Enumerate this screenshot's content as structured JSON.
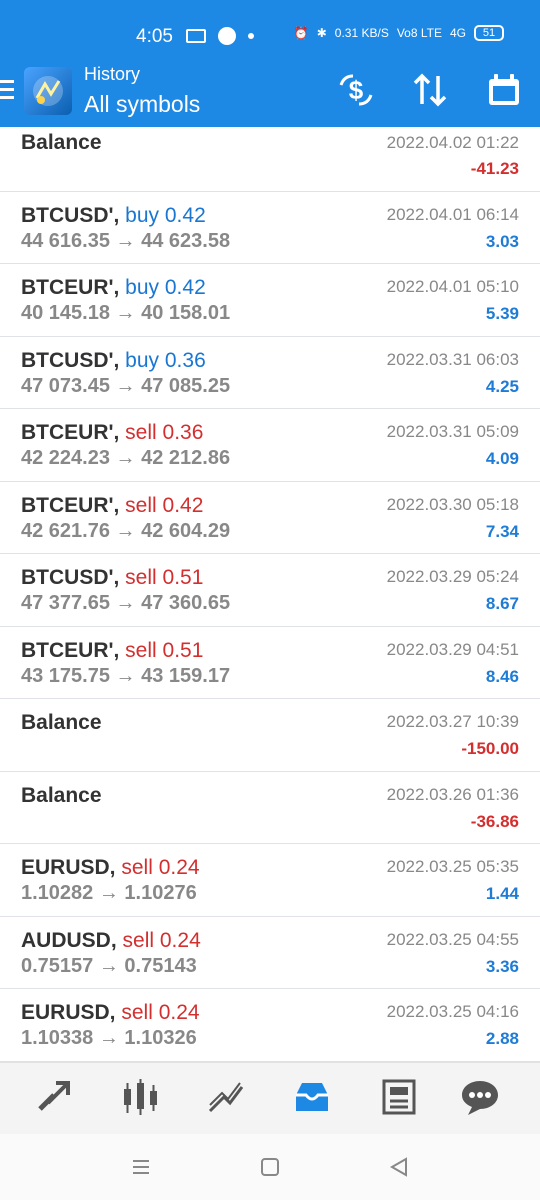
{
  "status_bar": {
    "time": "4:05",
    "net_speed": "0.31 KB/S",
    "volte": "Vo8 LTE",
    "signal": "4G",
    "battery": "51"
  },
  "header": {
    "title": "History",
    "subtitle": "All symbols"
  },
  "toolbar_icons": [
    "currency-exchange-icon",
    "sort-icon",
    "calendar-icon"
  ],
  "rows": [
    {
      "symbol": "Balance",
      "action": "",
      "volume": "",
      "prices": "",
      "date": "2022.04.02 01:22",
      "profit": "-41.23",
      "profit_sign": "neg"
    },
    {
      "symbol": "BTCUSD',",
      "action": "buy",
      "volume": "0.42",
      "prices": "44 616.35 → 44 623.58",
      "date": "2022.04.01 06:14",
      "profit": "3.03",
      "profit_sign": "pos"
    },
    {
      "symbol": "BTCEUR',",
      "action": "buy",
      "volume": "0.42",
      "prices": "40 145.18 → 40 158.01",
      "date": "2022.04.01 05:10",
      "profit": "5.39",
      "profit_sign": "pos"
    },
    {
      "symbol": "BTCUSD',",
      "action": "buy",
      "volume": "0.36",
      "prices": "47 073.45 → 47 085.25",
      "date": "2022.03.31 06:03",
      "profit": "4.25",
      "profit_sign": "pos"
    },
    {
      "symbol": "BTCEUR',",
      "action": "sell",
      "volume": "0.36",
      "prices": "42 224.23 → 42 212.86",
      "date": "2022.03.31 05:09",
      "profit": "4.09",
      "profit_sign": "pos"
    },
    {
      "symbol": "BTCEUR',",
      "action": "sell",
      "volume": "0.42",
      "prices": "42 621.76 → 42 604.29",
      "date": "2022.03.30 05:18",
      "profit": "7.34",
      "profit_sign": "pos"
    },
    {
      "symbol": "BTCUSD',",
      "action": "sell",
      "volume": "0.51",
      "prices": "47 377.65 → 47 360.65",
      "date": "2022.03.29 05:24",
      "profit": "8.67",
      "profit_sign": "pos"
    },
    {
      "symbol": "BTCEUR',",
      "action": "sell",
      "volume": "0.51",
      "prices": "43 175.75 → 43 159.17",
      "date": "2022.03.29 04:51",
      "profit": "8.46",
      "profit_sign": "pos"
    },
    {
      "symbol": "Balance",
      "action": "",
      "volume": "",
      "prices": "",
      "date": "2022.03.27 10:39",
      "profit": "-150.00",
      "profit_sign": "neg"
    },
    {
      "symbol": "Balance",
      "action": "",
      "volume": "",
      "prices": "",
      "date": "2022.03.26 01:36",
      "profit": "-36.86",
      "profit_sign": "neg"
    },
    {
      "symbol": "EURUSD,",
      "action": "sell",
      "volume": "0.24",
      "prices": "1.10282 → 1.10276",
      "date": "2022.03.25 05:35",
      "profit": "1.44",
      "profit_sign": "pos"
    },
    {
      "symbol": "AUDUSD,",
      "action": "sell",
      "volume": "0.24",
      "prices": "0.75157 → 0.75143",
      "date": "2022.03.25 04:55",
      "profit": "3.36",
      "profit_sign": "pos"
    },
    {
      "symbol": "EURUSD,",
      "action": "sell",
      "volume": "0.24",
      "prices": "1.10338 → 1.10326",
      "date": "2022.03.25 04:16",
      "profit": "2.88",
      "profit_sign": "pos"
    }
  ],
  "bottom_nav": [
    "quotes-icon",
    "chart-icon",
    "trade-icon",
    "history-icon",
    "news-icon",
    "chat-icon"
  ],
  "active_nav": "history-icon",
  "colors": {
    "header": "#1e88e5",
    "buy": "#1976d2",
    "sell": "#d32f2f",
    "profit_pos": "#1e7bd6",
    "profit_neg": "#d32f2f"
  }
}
